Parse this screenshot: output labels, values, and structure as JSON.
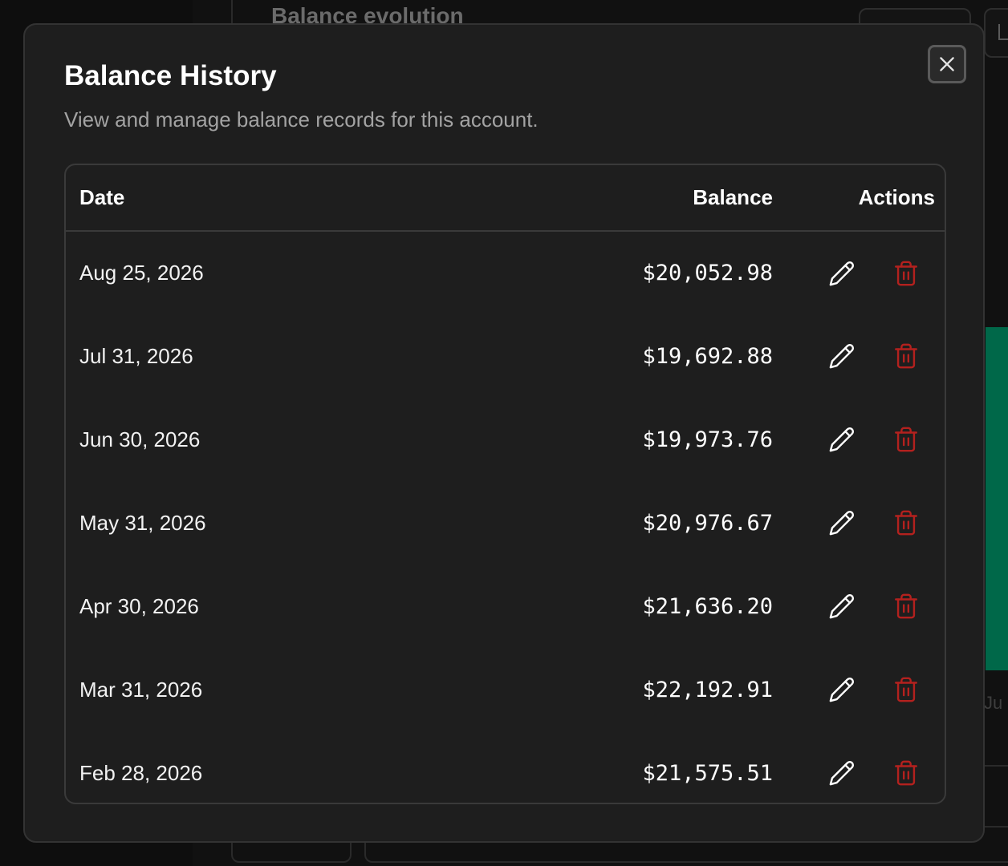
{
  "background": {
    "section_title": "Balance evolution",
    "axis_label": "Ju"
  },
  "dialog": {
    "title": "Balance History",
    "description": "View and manage balance records for this account.",
    "close_icon": "close-icon"
  },
  "table": {
    "headers": {
      "date": "Date",
      "balance": "Balance",
      "actions": "Actions"
    },
    "rows": [
      {
        "date": "Aug 25, 2026",
        "balance": "$20,052.98"
      },
      {
        "date": "Jul 31, 2026",
        "balance": "$19,692.88"
      },
      {
        "date": "Jun 30, 2026",
        "balance": "$19,973.76"
      },
      {
        "date": "May 31, 2026",
        "balance": "$20,976.67"
      },
      {
        "date": "Apr 30, 2026",
        "balance": "$21,636.20"
      },
      {
        "date": "Mar 31, 2026",
        "balance": "$22,192.91"
      },
      {
        "date": "Feb 28, 2026",
        "balance": "$21,575.51"
      }
    ],
    "row_action_icons": {
      "edit": "pencil-icon",
      "delete": "trash-icon"
    }
  },
  "colors": {
    "dialog_bg": "#1e1e1e",
    "delete_icon": "#b3211e",
    "accent_bar": "#006849"
  }
}
